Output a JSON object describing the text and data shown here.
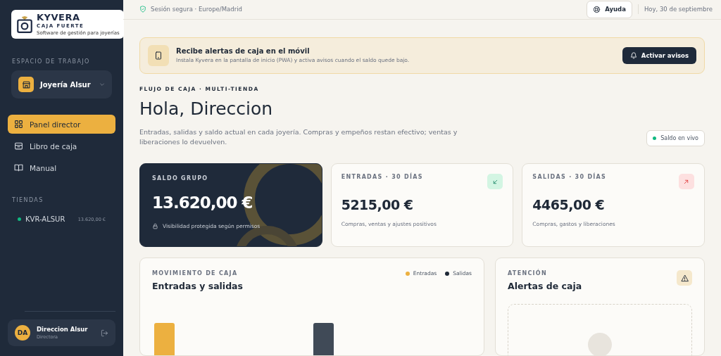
{
  "sidebar": {
    "logo": {
      "name": "KYVERA",
      "subtitle": "CAJA FUERTE",
      "tagline": "Software de gestión para joyerías"
    },
    "workspace_label": "ESPACIO DE TRABAJO",
    "workspace": {
      "name": "Joyería Alsur"
    },
    "nav": [
      {
        "kind": "grid",
        "label": "Panel director",
        "selected": true
      },
      {
        "kind": "archive",
        "label": "Libro de caja",
        "selected": false
      },
      {
        "kind": "book",
        "label": "Manual",
        "selected": false
      }
    ],
    "stores_label": "TIENDAS",
    "stores": [
      {
        "name": "KVR-ALSUR",
        "amount": "13.620,00 €",
        "color": "#10b981"
      }
    ],
    "user": {
      "initials": "DA",
      "name": "Direccion Alsur",
      "role": "Directora"
    }
  },
  "topbar": {
    "session": "Sesión segura · Europe/Madrid",
    "help": "Ayuda",
    "date": "Hoy, 30 de septiembre"
  },
  "banner": {
    "title": "Recibe alertas de caja en el móvil",
    "text": "Instala Kyvera en la pantalla de inicio (PWA) y activa avisos cuando el saldo quede bajo.",
    "button": "Activar avisos"
  },
  "eyebrow": "FLUJO DE CAJA · MULTI-TIENDA",
  "heading": "Hola, Direccion",
  "intro": "Entradas, salidas y saldo actual en cada joyería. Compras y empeños restan efectivo; ventas y liberaciones lo devuelven.",
  "live_badge": "Saldo en vivo",
  "cards": [
    {
      "kind": "dark",
      "label": "SALDO GRUPO",
      "value": "13.620,00 €",
      "note": "Visibilidad protegida según permisos"
    },
    {
      "kind": "in",
      "label": "ENTRADAS · 30 DÍAS",
      "value": "5215,00 €",
      "note": "Compras, ventas y ajustes positivos"
    },
    {
      "kind": "out",
      "label": "SALIDAS · 30 DÍAS",
      "value": "4465,00 €",
      "note": "Compras, gastos y liberaciones"
    }
  ],
  "movement": {
    "eyebrow": "MOVIMIENTO DE CAJA",
    "title": "Entradas y salidas",
    "legend": [
      {
        "label": "Entradas",
        "color": "#ecb040"
      },
      {
        "label": "Salidas",
        "color": "#1f2937"
      }
    ]
  },
  "alerts": {
    "eyebrow": "ATENCIÓN",
    "title": "Alertas de caja"
  }
}
